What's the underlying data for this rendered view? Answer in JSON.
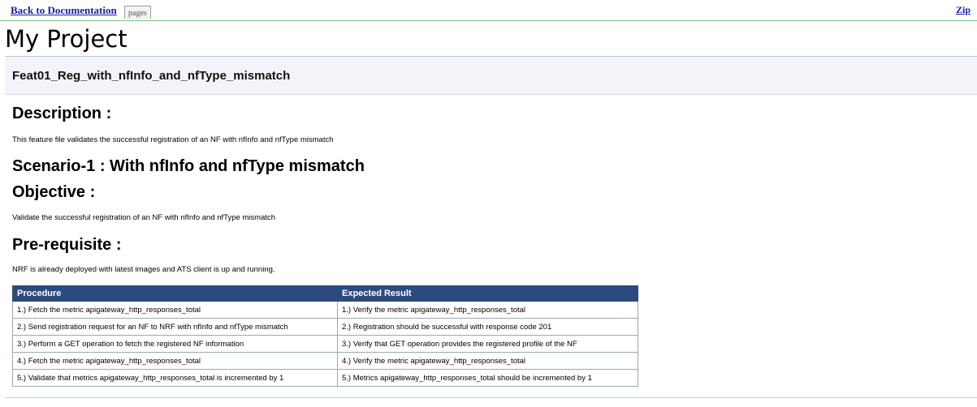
{
  "nav": {
    "back_label": "Back to Documentation",
    "pages_label": "pages",
    "zip_label": "Zip"
  },
  "project_title": "My Project",
  "feature_name": "Feat01_Reg_with_nfInfo_and_nfType_mismatch",
  "description": {
    "heading": "Description :",
    "text": "This feature file validates the successful registration of an NF with nfInfo and nfType mismatch"
  },
  "scenario": {
    "heading": "Scenario-1 : With nfInfo and nfType mismatch",
    "objective_heading": "Objective :",
    "objective_text": "Validate the successful registration of an NF with nfInfo and nfType mismatch",
    "prereq_heading": "Pre-requisite :",
    "prereq_text": "NRF is already deployed with latest images and ATS client is up and running."
  },
  "table": {
    "headers": [
      "Procedure",
      "Expected Result"
    ],
    "rows": [
      [
        "1.) Fetch the metric apigateway_http_responses_total",
        "1.) Verify the metric apigateway_http_responses_total"
      ],
      [
        "2.) Send registration request for an NF to NRF with nfInfo and nfType mismatch",
        "2.) Registration should be successful with response code 201"
      ],
      [
        "3.) Perform a GET operation to fetch the registered NF information",
        "3.) Verify that GET operation provides the registered profile of the NF"
      ],
      [
        "4.) Fetch the metric apigateway_http_responses_total",
        "4.) Verify the metric apigateway_http_responses_total"
      ],
      [
        "5.) Validate that metrics apigateway_http_responses_total is incremented by 1",
        "5.) Metrics apigateway_http_responses_total should be incremented by 1"
      ]
    ]
  }
}
